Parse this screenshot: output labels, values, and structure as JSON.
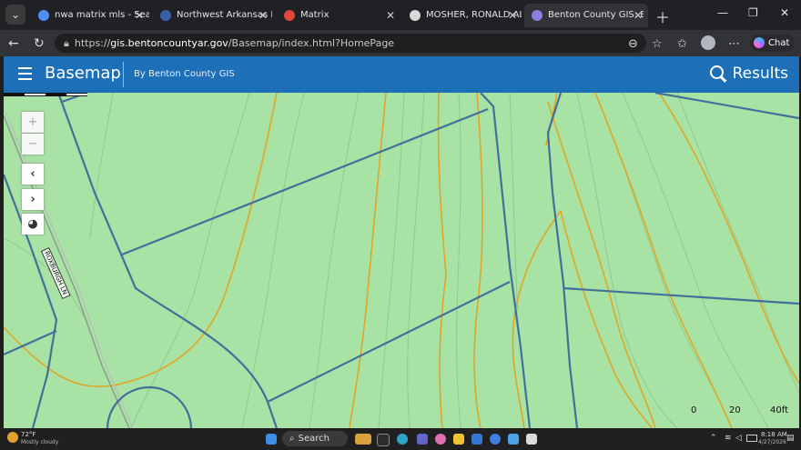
{
  "tabs": [
    {
      "label": "nwa matrix mls - Searc",
      "icon_color": "#4f8ef7",
      "icon": "search-icon"
    },
    {
      "label": "Northwest Arkansas B",
      "icon_color": "#3a5fa8",
      "icon": "site-icon"
    },
    {
      "label": "Matrix",
      "icon_color": "#e0483c",
      "icon": "matrix-icon"
    },
    {
      "label": "MOSHER, RONALD AL",
      "icon_color": "#d8d8d8",
      "icon": "record-icon"
    },
    {
      "label": "Benton County GIS: B",
      "icon_color": "#8a7fe0",
      "icon": "gis-icon"
    }
  ],
  "address": {
    "protocol": "https://",
    "host": "gis.bentoncountyar.gov",
    "path": "/Basemap/index.html?HomePage"
  },
  "browser": {
    "chat_label": "Chat"
  },
  "app": {
    "title": "Basemap",
    "subtitle": "By Benton County GIS",
    "results_label": "Results"
  },
  "map": {
    "road_label": "ROXBURGH LN",
    "scale_labels": [
      "0",
      "20",
      "40ft"
    ],
    "colors": {
      "background": "#a8e2a4",
      "parcel": "#43709a",
      "contour": "#e0a628",
      "contour_minor": "#93c98d"
    }
  },
  "taskbar": {
    "weather_temp": "72°F",
    "weather_desc": "Mostly cloudy",
    "search_label": "Search",
    "time": "8:18 AM",
    "date": "4/27/2026"
  }
}
